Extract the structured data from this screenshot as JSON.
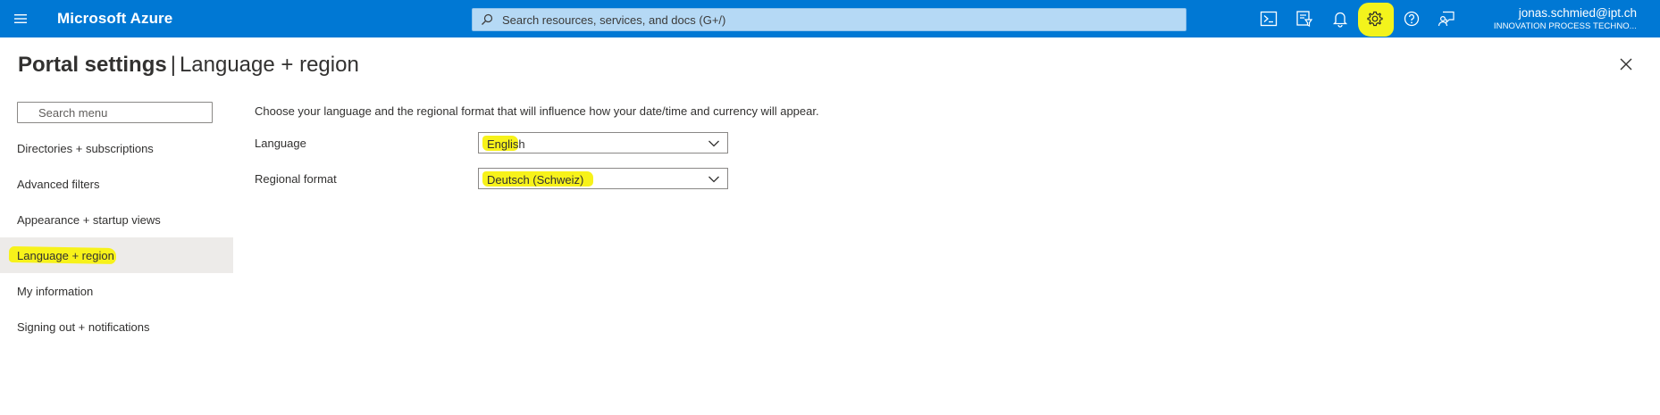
{
  "topbar": {
    "brand": "Microsoft Azure",
    "search_placeholder": "Search resources, services, and docs (G+/)",
    "user_email": "jonas.schmied@ipt.ch",
    "user_org": "INNOVATION PROCESS TECHNO...",
    "icons": [
      "menu-icon",
      "cloud-shell-icon",
      "directory-filter-icon",
      "notifications-icon",
      "settings-icon",
      "help-icon",
      "feedback-icon"
    ],
    "accent_color": "#0078d4",
    "highlight_color": "#f3f31c"
  },
  "page": {
    "title": "Portal settings",
    "separator": "|",
    "subtitle": "Language + region"
  },
  "sidebar": {
    "search_placeholder": "Search menu",
    "items": [
      {
        "label": "Directories + subscriptions"
      },
      {
        "label": "Advanced filters"
      },
      {
        "label": "Appearance + startup views"
      },
      {
        "label": "Language + region"
      },
      {
        "label": "My information"
      },
      {
        "label": "Signing out + notifications"
      }
    ],
    "selected_item": "Language + region"
  },
  "content": {
    "intro": "Choose your language and the regional format that will influence how your date/time and currency will appear.",
    "language_label": "Language",
    "language_value": "English",
    "regional_format_label": "Regional format",
    "regional_format_value": "Deutsch (Schweiz)"
  }
}
